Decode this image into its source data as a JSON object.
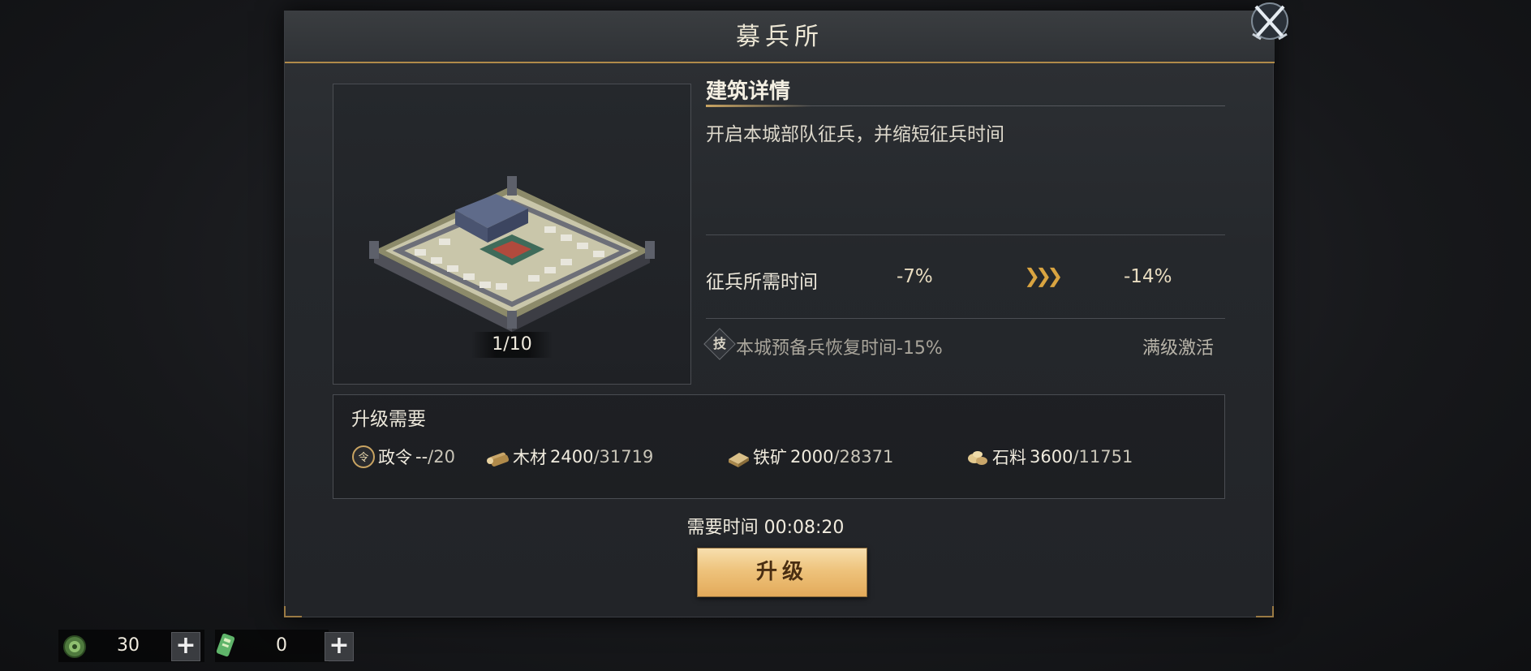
{
  "dialog": {
    "title": "募兵所",
    "level": "1/10",
    "details": {
      "heading": "建筑详情",
      "description": "开启本城部队征兵，并缩短征兵时间",
      "stat": {
        "label": "征兵所需时间",
        "current": "-7%",
        "arrow": "❯❯❯",
        "next": "-14%"
      },
      "tech": {
        "icon_glyph": "技",
        "label": "本城预备兵恢复时间-15%",
        "status": "满级激活"
      }
    },
    "requirements": {
      "heading": "升级需要",
      "resources": [
        {
          "icon": "order-icon",
          "name": "政令",
          "have": "--",
          "total": "20"
        },
        {
          "icon": "wood-icon",
          "name": "木材",
          "have": "2400",
          "total": "31719"
        },
        {
          "icon": "iron-icon",
          "name": "铁矿",
          "have": "2000",
          "total": "28371"
        },
        {
          "icon": "stone-icon",
          "name": "石料",
          "have": "3600",
          "total": "11751"
        }
      ]
    },
    "time_required": "需要时间 00:08:20",
    "upgrade_label": "升级"
  },
  "bottom": {
    "jade_count": "30",
    "token_count": "0",
    "plus": "+"
  },
  "colors": {
    "accent_gold": "#c9a462",
    "button_gold": "#eec37c",
    "panel": "#2a2c30"
  }
}
